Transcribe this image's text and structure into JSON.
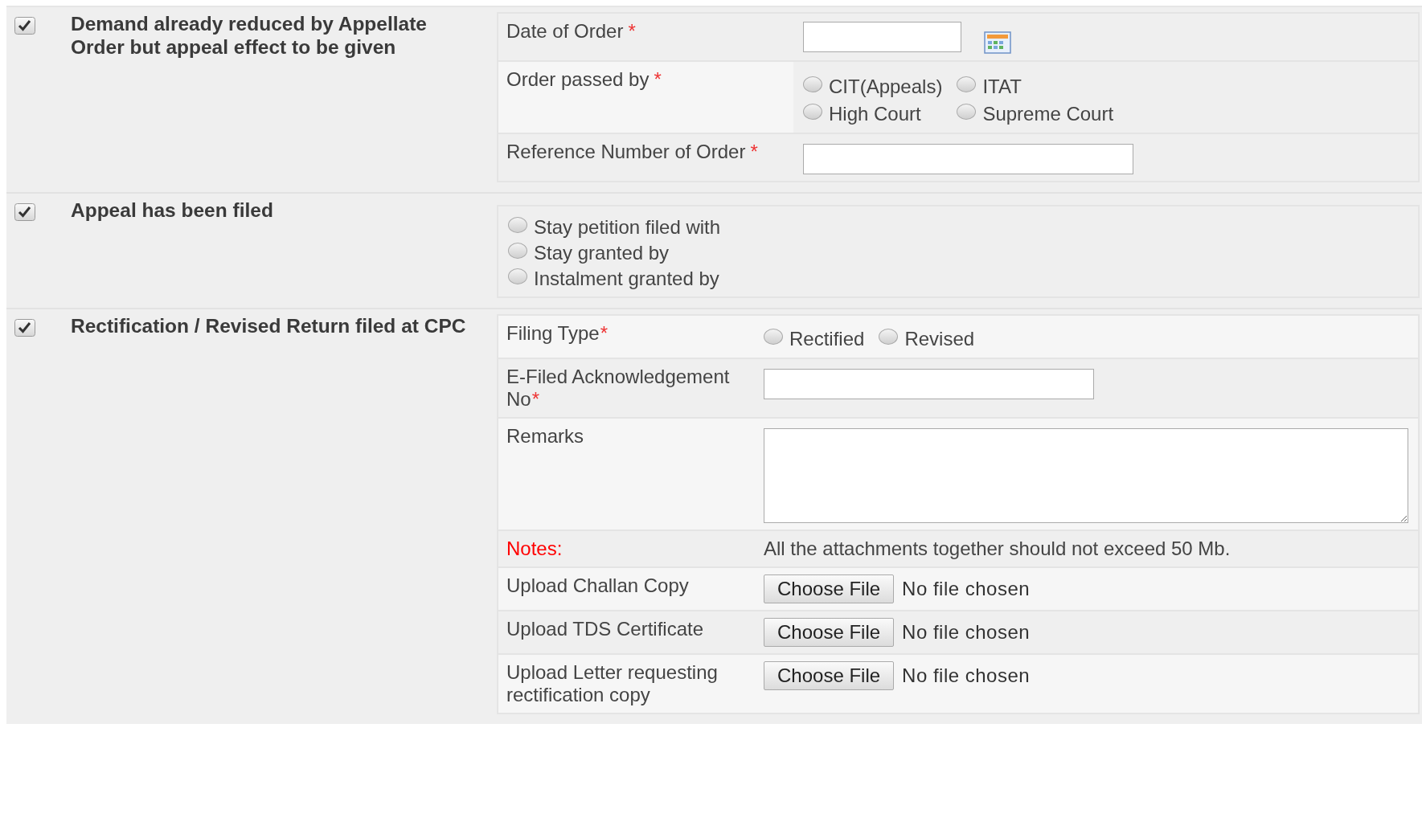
{
  "sections": [
    {
      "checked": true,
      "title": "Demand already reduced by Appellate Order but appeal effect to be given",
      "kind": "fields",
      "rows": [
        {
          "kind": "date",
          "label": "Date of Order",
          "required": "*"
        },
        {
          "kind": "radios",
          "label": "Order passed by",
          "required": "*",
          "options": [
            {
              "label": "CIT(Appeals)",
              "selected": false
            },
            {
              "label": "ITAT",
              "selected": false
            },
            {
              "label": "High Court",
              "selected": false
            },
            {
              "label": "Supreme Court",
              "selected": false
            }
          ]
        },
        {
          "kind": "text",
          "label": "Reference Number of Order",
          "required": "*"
        }
      ]
    },
    {
      "checked": true,
      "title": "Appeal has been filed",
      "kind": "options",
      "options": [
        {
          "label": "Stay petition filed with",
          "selected": false
        },
        {
          "label": "Stay granted by",
          "selected": false
        },
        {
          "label": "Instalment granted by",
          "selected": false
        }
      ]
    },
    {
      "checked": true,
      "title": "Rectification / Revised Return filed at CPC",
      "kind": "fields",
      "rows": [
        {
          "kind": "radios",
          "label": "Filing Type",
          "required": "*",
          "options": [
            {
              "label": "Rectified",
              "selected": false
            },
            {
              "label": "Revised",
              "selected": false
            }
          ]
        },
        {
          "kind": "text",
          "label": "E-Filed Acknowledgement No",
          "required": "*"
        },
        {
          "kind": "textarea",
          "label": "Remarks"
        },
        {
          "kind": "note",
          "label": "Notes:",
          "text": "All the attachments together should not exceed 50 Mb."
        },
        {
          "kind": "file",
          "label": "Upload Challan Copy",
          "button": "Choose File",
          "status": "No file chosen"
        },
        {
          "kind": "file",
          "label": "Upload TDS Certificate",
          "button": "Choose File",
          "status": "No file chosen"
        },
        {
          "kind": "file",
          "label": "Upload Letter requesting rectification copy",
          "button": "Choose File",
          "status": "No file chosen"
        }
      ]
    }
  ]
}
